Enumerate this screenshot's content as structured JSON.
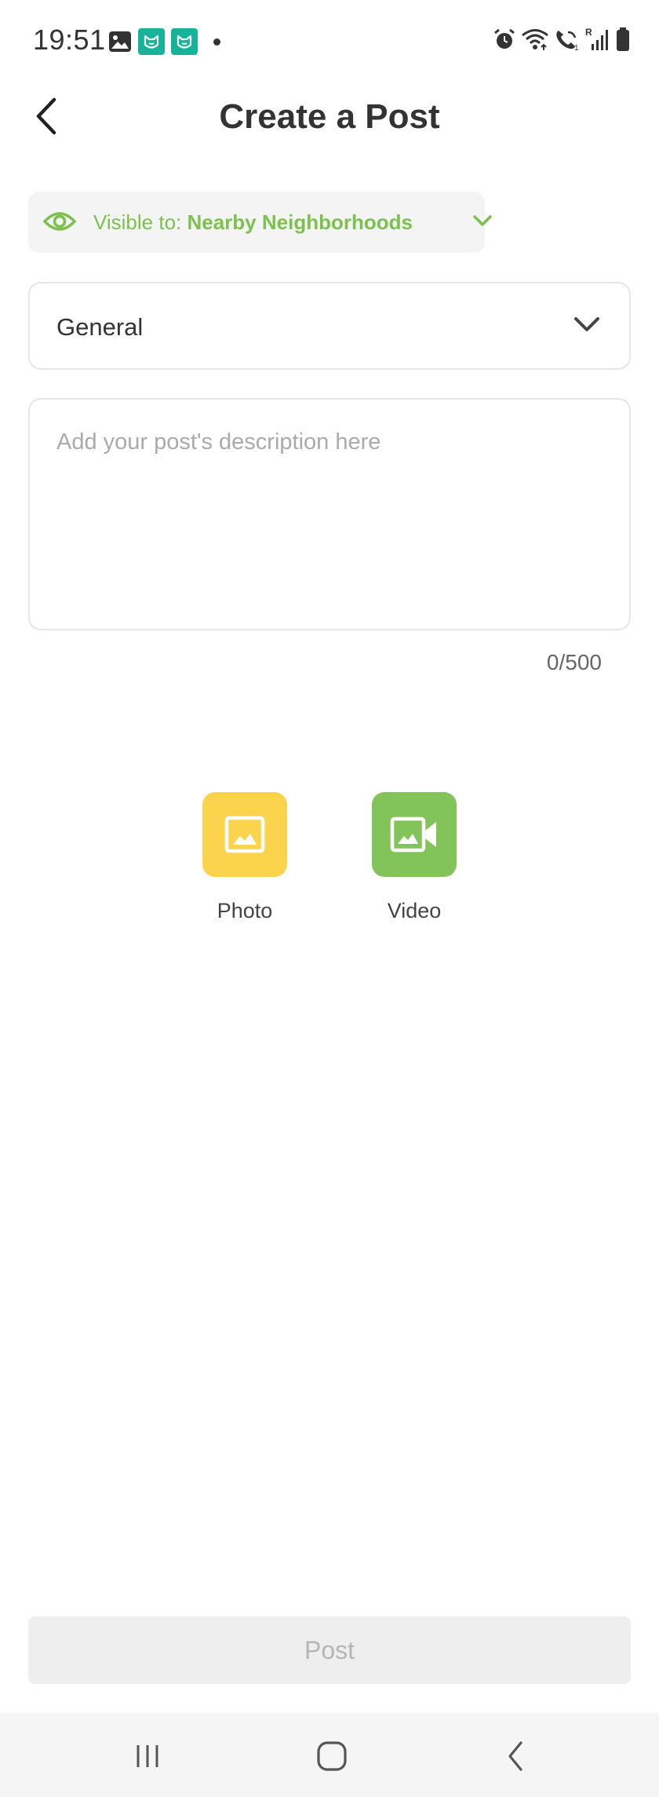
{
  "status_bar": {
    "time": "19:51",
    "left_icons": [
      "gallery-icon",
      "app-notification-icon",
      "app-notification-icon",
      "dot-icon"
    ],
    "right_icons": [
      "alarm-icon",
      "wifi-icon",
      "wifi-calling-icon",
      "signal-icon",
      "battery-icon"
    ],
    "signal_label": "R"
  },
  "header": {
    "title": "Create a Post"
  },
  "visibility": {
    "prefix": "Visible to: ",
    "value": "Nearby Neighborhoods"
  },
  "category": {
    "selected": "General"
  },
  "description": {
    "placeholder": "Add your post's description here",
    "value": "",
    "counter": "0/500"
  },
  "media": {
    "photo_label": "Photo",
    "video_label": "Video"
  },
  "post_button": {
    "label": "Post"
  },
  "colors": {
    "accent_green": "#7cc04e",
    "photo_yellow": "#fcd34d",
    "video_green": "#82c35a",
    "app_teal": "#16b39a",
    "disabled_gray": "#eeeeee"
  }
}
